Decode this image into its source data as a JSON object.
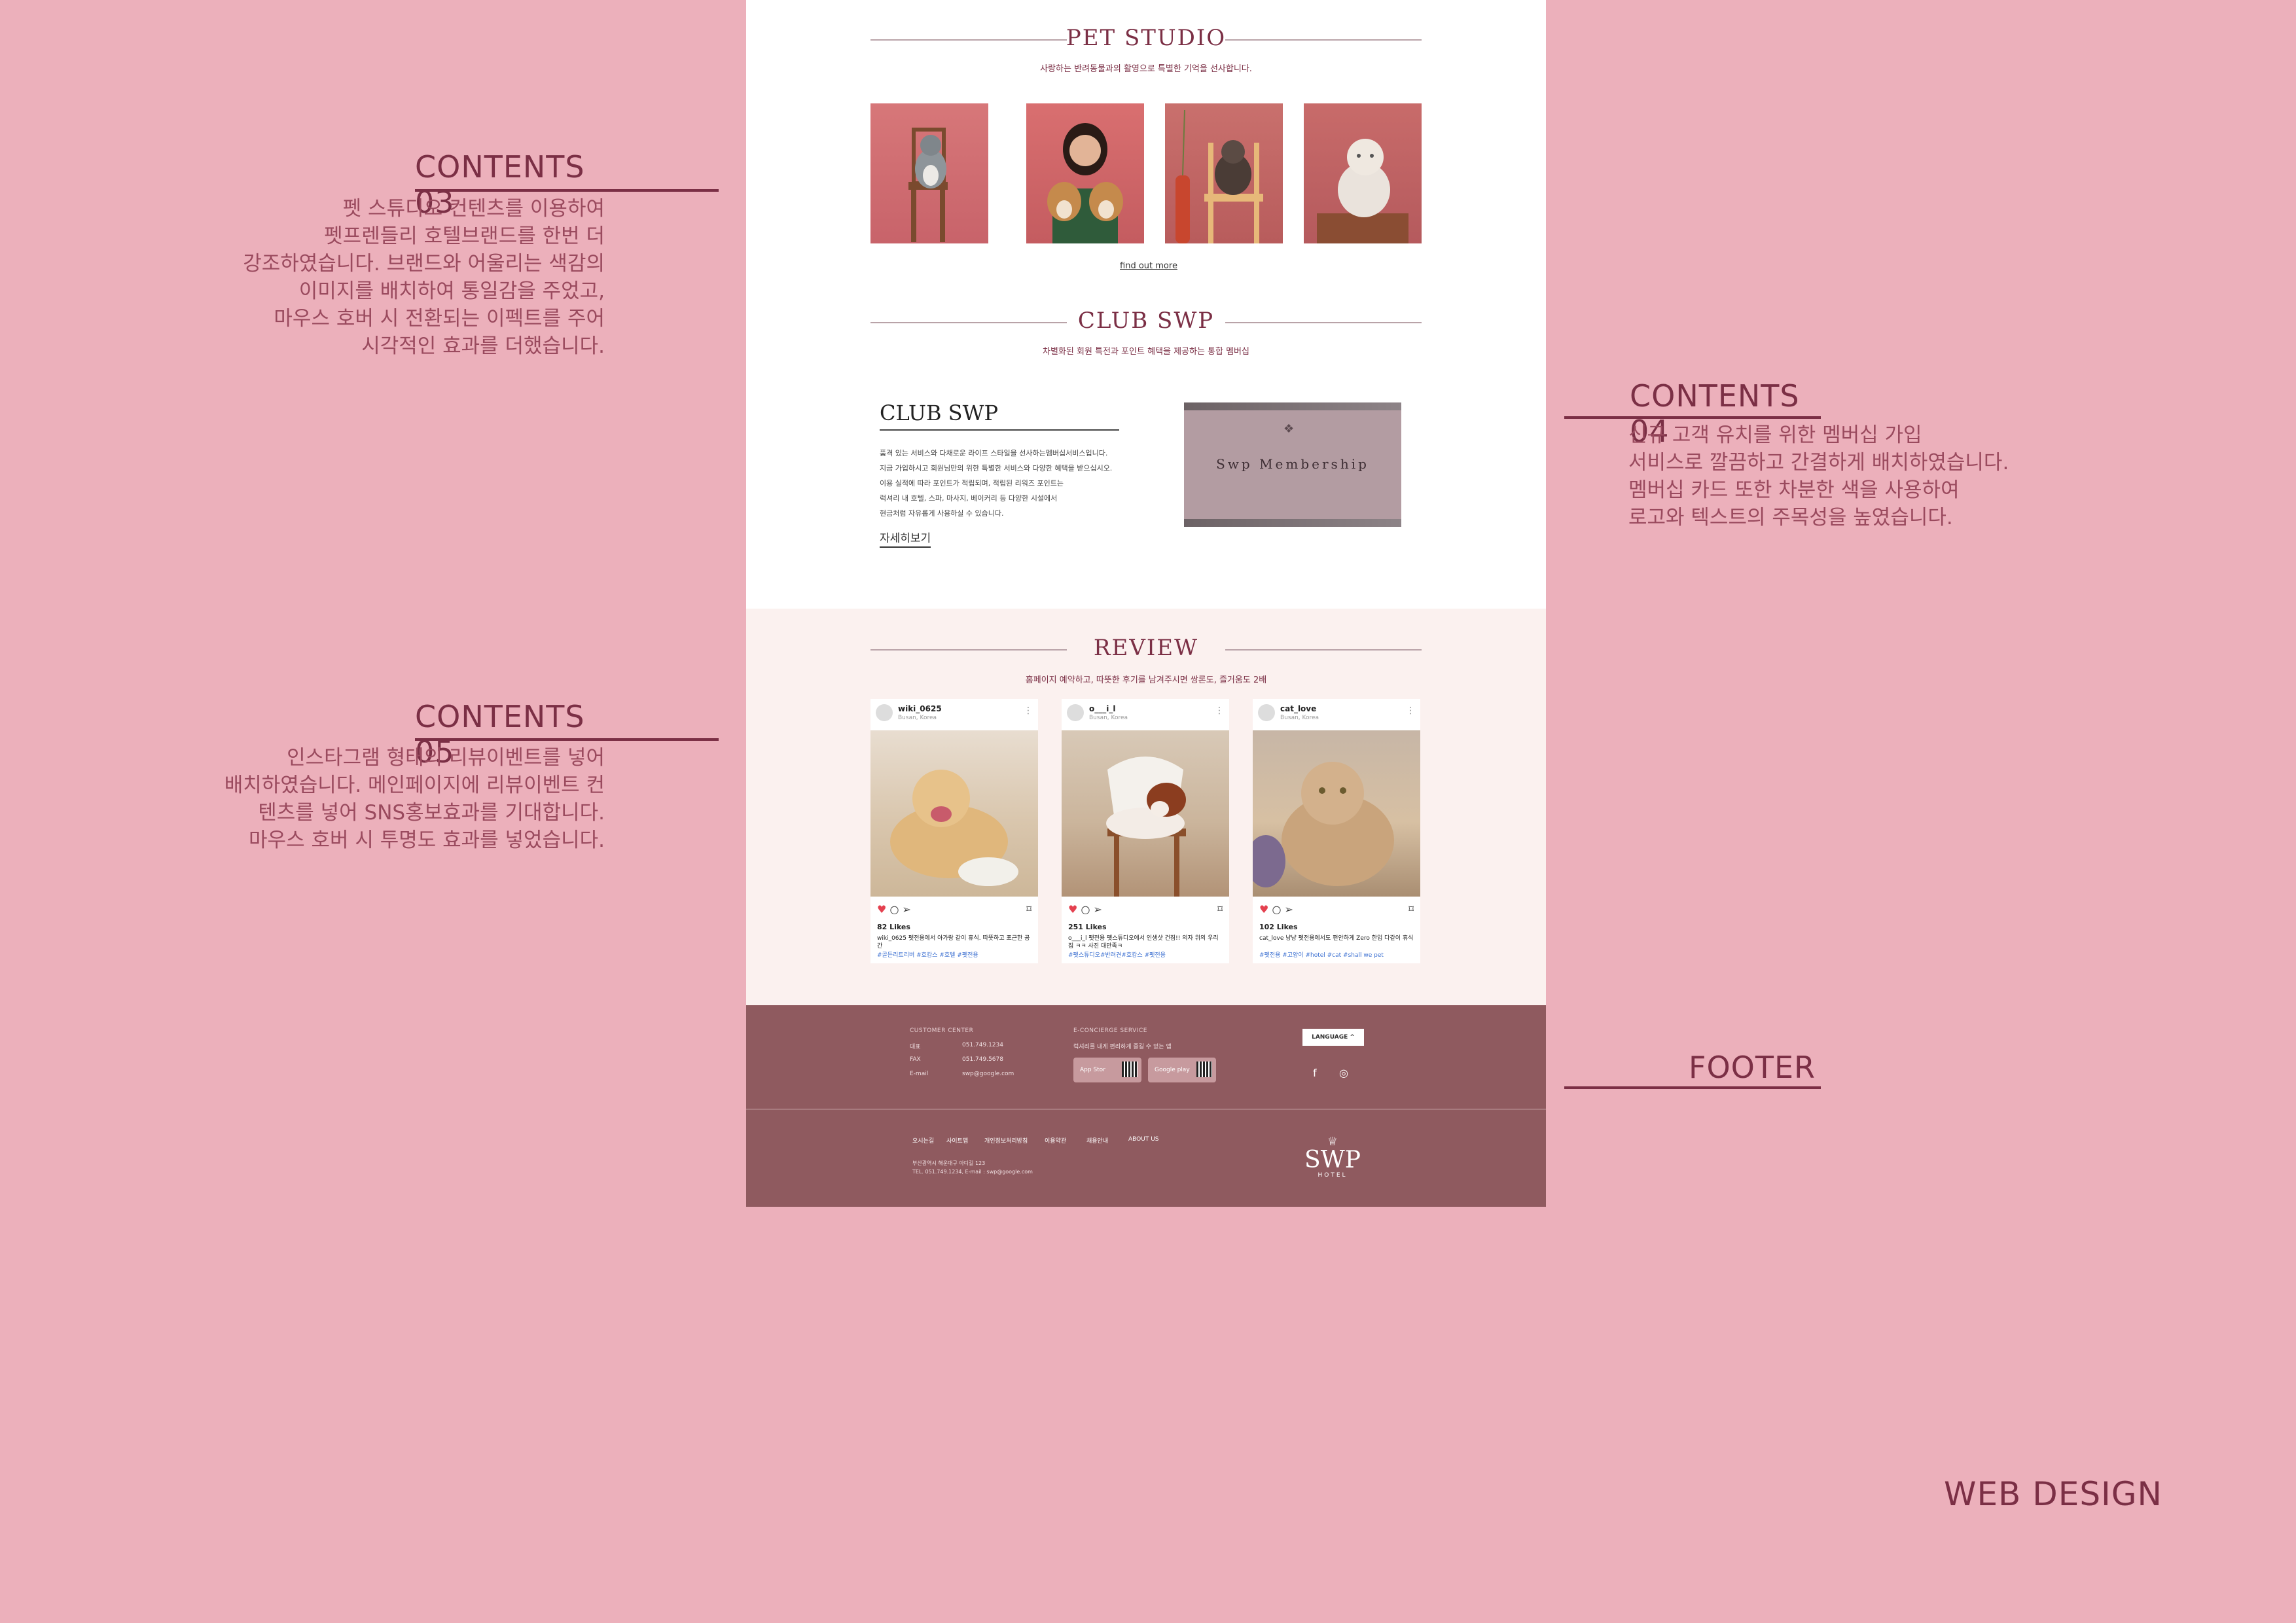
{
  "annotations": {
    "c03": {
      "title": "CONTENTS 03",
      "text": "펫 스튜디오 컨텐츠를 이용하여\n펫프렌들리 호텔브랜드를 한번 더\n강조하였습니다. 브랜드와 어울리는 색감의\n이미지를 배치하여 통일감을 주었고,\n마우스 호버 시 전환되는 이펙트를 주어\n시각적인 효과를 더했습니다."
    },
    "c04": {
      "title": "CONTENTS 04",
      "text": "신규 고객 유치를 위한 멤버십 가입\n서비스로 깔끔하고 간결하게 배치하였습니다.\n멤버십 카드 또한 차분한 색을 사용하여\n로고와 텍스트의 주목성을 높였습니다."
    },
    "c05": {
      "title": "CONTENTS 05",
      "text": "인스타그램 형태의 리뷰이벤트를 넣어\n배치하였습니다. 메인페이지에 리뷰이벤트 컨\n텐츠를 넣어 SNS홍보효과를 기대합니다.\n마우스 호버 시 투명도 효과를 넣었습니다."
    },
    "footer": {
      "title": "FOOTER"
    },
    "web_design": "WEB DESIGN"
  },
  "pet_studio": {
    "title": "PET STUDIO",
    "subtitle": "사랑하는 반려동물과의 활영으로 특별한 기억을 선사합니다.",
    "find_more": "find out more"
  },
  "club": {
    "heading": "CLUB SWP",
    "subtitle": "차별화된 회원 특전과 포인트 혜택을 제공하는 통합 멤버십",
    "title": "CLUB SWP",
    "lines": [
      "품격 있는 서비스와 다채로운 라이프 스타일을 선사하는멤버십서비스입니다.",
      "지금 가입하시고 회원님만의 위한 특별한 서비스와 다양한 혜택을 받으십시오.",
      "이용 실적에 따라 포인트가 적립되며, 적립된 리워즈 포인트는",
      "럭셔리 내 호텔, 스파, 마사지, 베이커리 등 다양한 시설에서",
      "현금처럼 자유롭게 사용하실 수 있습니다."
    ],
    "more": "자세히보기",
    "card_logo": "❖",
    "card_name": "Swp Membership"
  },
  "review": {
    "title": "REVIEW",
    "subtitle": "홈페이지 예약하고, 따뜻한 후기를 남겨주시면 쌍론도, 즐거움도 2배",
    "posts": [
      {
        "user": "wiki_0625",
        "loc": "Busan, Korea",
        "likes": "82 Likes",
        "caption": "wiki_0625 펫전용에서 아가랑 같이 휴식. 따뜻하고 포근한 공간",
        "tags": "#골든리트리버 #호캉스 #호텔 #펫전용"
      },
      {
        "user": "o___i_l",
        "loc": "Busan, Korea",
        "likes": "251 Likes",
        "caption": "o___i_l 펫전용 펫스튜디오에서 인생샷 건짐!! 의자 위의 우리집 ㅋㅋ 사진 대만족ㅋ",
        "tags": "#펫스튜디오#반려견#호캉스 #펫전용"
      },
      {
        "user": "cat_love",
        "loc": "Busan, Korea",
        "likes": "102 Likes",
        "caption": "cat_love 냥냥 펫전용에서도 편안하게 Zero 한입 다같이 휴식",
        "tags": "#펫전용 #고양이 #hotel #cat #shall we pet"
      }
    ]
  },
  "footer": {
    "customer_center": "CUSTOMER CENTER",
    "tel_label": "대표",
    "tel": "051.749.1234",
    "fax_label": "FAX",
    "fax": "051.749.5678",
    "email_label": "E-mail",
    "email": "swp@google.com",
    "concierge": "E-CONCIERGE SERVICE",
    "concierge_desc": "럭셔리를 내게 편리하게 즐길 수 있는 앱",
    "app_store": "App Stor",
    "google_play": "Google play",
    "language": "LANGUAGE",
    "nav": [
      "오시는길",
      "사이트맵",
      "개인정보처리방침",
      "이용약관",
      "채용안내",
      "ABOUT US"
    ],
    "address": "부산광역시 해운대구 아디길 123",
    "contact": "TEL. 051.749.1234, E-mail : swp@google.com",
    "logo_word": "SWP",
    "logo_sub": "HOTEL"
  },
  "colors": {
    "bg": "#ecb0bb",
    "accent": "#7b2f45",
    "footer": "#8f5a5f"
  }
}
